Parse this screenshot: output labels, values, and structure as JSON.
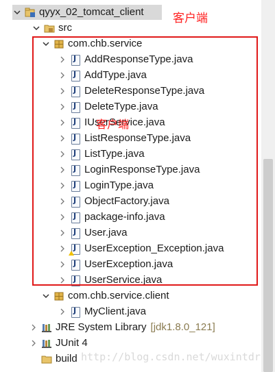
{
  "project": {
    "name": "qyyx_02_tomcat_client"
  },
  "src_folder": {
    "label": "src"
  },
  "packages": [
    {
      "name": "com.chb.service",
      "files": [
        "AddResponseType.java",
        "AddType.java",
        "DeleteResponseType.java",
        "DeleteType.java",
        "IUserService.java",
        "ListResponseType.java",
        "ListType.java",
        "LoginResponseType.java",
        "LoginType.java",
        "ObjectFactory.java",
        "package-info.java",
        "User.java",
        "UserException_Exception.java",
        "UserException.java",
        "UserService.java"
      ]
    },
    {
      "name": "com.chb.service.client",
      "files": [
        "MyClient.java"
      ]
    }
  ],
  "libraries": [
    {
      "label": "JRE System Library",
      "version": "[jdk1.8.0_121]"
    },
    {
      "label": "JUnit 4",
      "version": ""
    }
  ],
  "build_folder": {
    "label": "build"
  },
  "annotations": {
    "title_note": "客户端",
    "box_note": "客户端"
  },
  "watermark": "http://blog.csdn.net/wuxintdrh",
  "colors": {
    "annotation": "#ff1f1f",
    "selection": "#d9d9d9"
  }
}
